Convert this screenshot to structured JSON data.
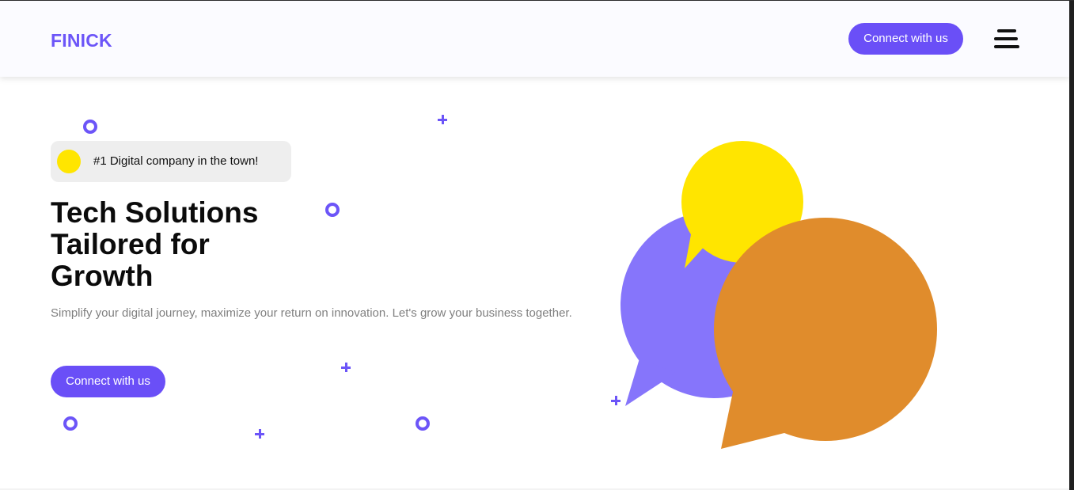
{
  "header": {
    "logo": "FINICK",
    "connect_label": "Connect with us",
    "menu_icon": "hamburger-menu-icon"
  },
  "hero": {
    "badge_text": "#1 Digital company in the town!",
    "title": "Tech Solutions Tailored for Growth",
    "description": "Simplify your digital journey, maximize your return on innovation. Let's grow your business together.",
    "cta_label": "Connect with us"
  },
  "colors": {
    "accent": "#6a4ff7",
    "bubble_purple": "#8675fb",
    "bubble_yellow": "#ffe500",
    "bubble_orange": "#e08c2c",
    "badge_bg": "#eeeeee"
  }
}
